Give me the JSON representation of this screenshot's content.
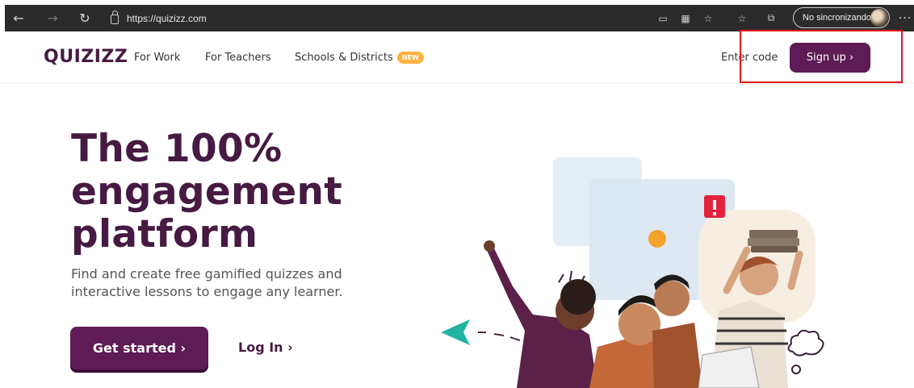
{
  "browser": {
    "url": "https://quizizz.com",
    "profile_label": "No sincronizando",
    "nav_icons": [
      "back-icon",
      "forward-icon",
      "reload-icon"
    ]
  },
  "site": {
    "logo": "QUIZIZZ",
    "nav": {
      "for_work": "For Work",
      "for_teachers": "For Teachers",
      "schools_districts": "Schools & Districts",
      "new_badge": "NEW",
      "enter_code": "Enter code",
      "signup": "Sign up ›"
    },
    "brand_color": "#5e1b55",
    "accent_color": "#ffb23f"
  },
  "hero": {
    "title_line1": "The 100%",
    "title_line2": "engagement",
    "title_line3": "platform",
    "subtitle": "Find and create free gamified quizzes and interactive lessons to engage any learner.",
    "get_started": "Get started ›",
    "login": "Log In ›"
  }
}
